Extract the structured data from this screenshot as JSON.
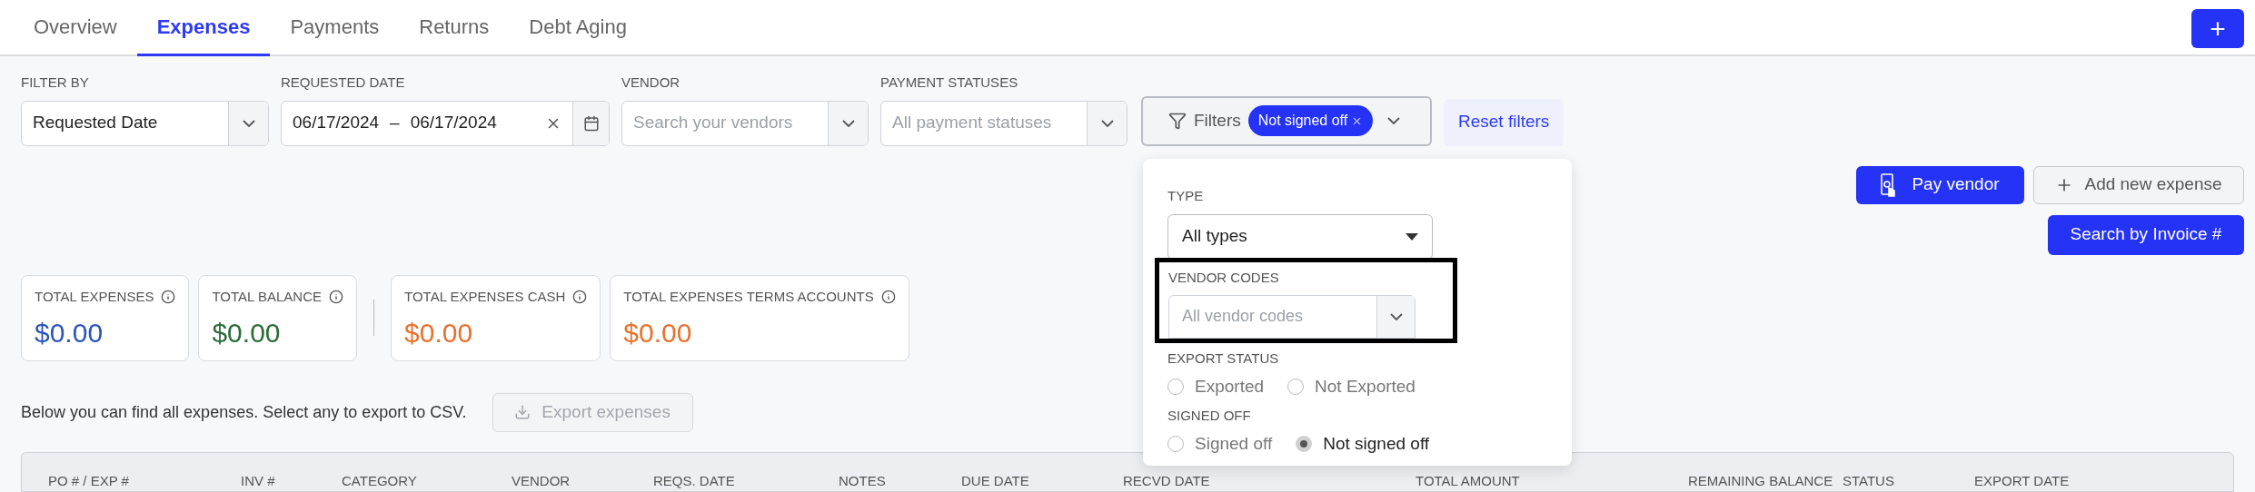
{
  "tabs": [
    {
      "label": "Overview",
      "selected": false
    },
    {
      "label": "Expenses",
      "selected": true
    },
    {
      "label": "Payments",
      "selected": false
    },
    {
      "label": "Returns",
      "selected": false
    },
    {
      "label": "Debt Aging",
      "selected": false
    }
  ],
  "add_button": "+",
  "filters": [
    {
      "kind": "select",
      "label": "FILTER BY",
      "value": "Requested Date"
    },
    {
      "kind": "daterange",
      "label": "REQUESTED DATE",
      "start": "06/17/2024",
      "separator": "–",
      "end": "06/17/2024"
    },
    {
      "kind": "select",
      "label": "VENDOR",
      "placeholder": "Search your vendors"
    },
    {
      "kind": "select",
      "label": "PAYMENT STATUSES",
      "placeholder": "All payment statuses"
    }
  ],
  "filters_button": {
    "label": "Filters",
    "chip": "Not signed off"
  },
  "reset_filters": "Reset filters",
  "popup": {
    "type_label": "TYPE",
    "type_value": "All types",
    "vendor_codes_label": "VENDOR CODES",
    "vendor_codes_placeholder": "All vendor codes",
    "groups": [
      {
        "label": "EXPORT STATUS",
        "options": [
          {
            "label": "Exported",
            "selected": false
          },
          {
            "label": "Not Exported",
            "selected": false
          }
        ]
      },
      {
        "label": "SIGNED OFF",
        "options": [
          {
            "label": "Signed off",
            "selected": false
          },
          {
            "label": "Not signed off",
            "selected": true
          }
        ]
      }
    ]
  },
  "actions": {
    "pay_vendor": "Pay vendor",
    "add_expense": "Add new expense",
    "search_invoice": "Search by Invoice #"
  },
  "stats": [
    {
      "label": "TOTAL EXPENSES",
      "value": "$0.00",
      "color": "#2d55b8"
    },
    {
      "label": "TOTAL BALANCE",
      "value": "$0.00",
      "color": "#2e6b3a"
    },
    {
      "label": "TOTAL EXPENSES CASH",
      "value": "$0.00",
      "color": "#e8712d"
    },
    {
      "label": "TOTAL EXPENSES TERMS ACCOUNTS",
      "value": "$0.00",
      "color": "#e8712d"
    }
  ],
  "description": "Below you can find all expenses. Select any to export to CSV.",
  "export_button": {
    "label": "Export expenses",
    "disabled": true
  },
  "table": {
    "columns": [
      "PO # / EXP #",
      "INV #",
      "CATEGORY",
      "VENDOR",
      "REQS. DATE",
      "NOTES",
      "DUE DATE",
      "RECVD DATE",
      "TOTAL AMOUNT",
      "REMAINING BALANCE",
      "STATUS",
      "EXPORT DATE"
    ]
  }
}
